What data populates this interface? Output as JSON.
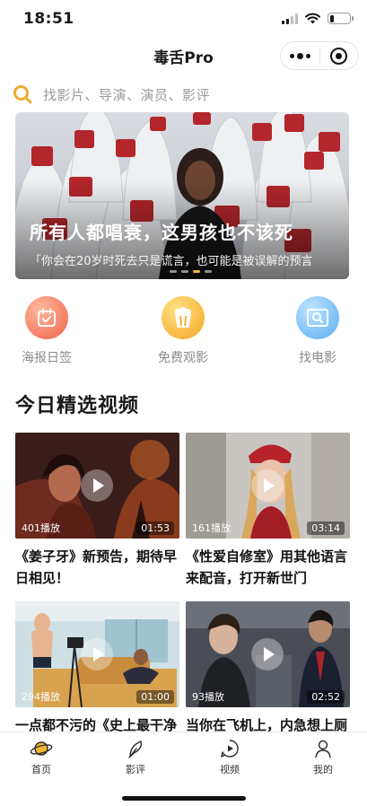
{
  "status_bar": {
    "time": "18:51",
    "battery_level": 0.2
  },
  "nav": {
    "title": "毒舌Pro",
    "more_icon": "more-dots-icon",
    "close_icon": "target-circle-icon"
  },
  "search": {
    "placeholder": "找影片、导演、演员、影评",
    "icon": "search-icon"
  },
  "banner": {
    "title": "所有人都唱衰，这男孩也不该死",
    "subtitle": "「你会在20岁时死去只是谎言，也可能是被误解的预言",
    "page_count": 4,
    "active_page": 2
  },
  "quick_menu": [
    {
      "label": "海报日签",
      "icon": "calendar-icon",
      "color": "#f0634a"
    },
    {
      "label": "免费观影",
      "icon": "popcorn-icon",
      "color": "#f5a623"
    },
    {
      "label": "找电影",
      "icon": "film-search-icon",
      "color": "#5aaef3"
    }
  ],
  "section": {
    "title": "今日精选视频"
  },
  "videos": [
    {
      "views": "401播放",
      "duration": "01:53",
      "title": "《姜子牙》新预告，期待早日相见！"
    },
    {
      "views": "161播放",
      "duration": "03:14",
      "title": "《性爱自修室》用其他语言来配音，打开新世门"
    },
    {
      "views": "294播放",
      "duration": "01:00",
      "title": "一点都不污的《史上最干净"
    },
    {
      "views": "93播放",
      "duration": "02:52",
      "title": "当你在飞机上，内急想上厕"
    }
  ],
  "tabbar": [
    {
      "label": "首页",
      "icon": "planet-icon",
      "active": true
    },
    {
      "label": "影评",
      "icon": "feather-icon",
      "active": false
    },
    {
      "label": "视频",
      "icon": "video-play-icon",
      "active": false
    },
    {
      "label": "我的",
      "icon": "user-icon",
      "active": false
    }
  ],
  "colors": {
    "accent": "#f0b43b",
    "text_primary": "#1a1a1a",
    "text_muted": "#9b9b9b"
  }
}
